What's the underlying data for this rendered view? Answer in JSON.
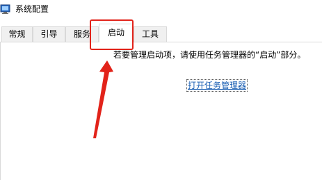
{
  "window": {
    "title": "系统配置",
    "icon": "msconfig-icon"
  },
  "tabs": [
    {
      "label": "常规",
      "active": false
    },
    {
      "label": "引导",
      "active": false
    },
    {
      "label": "服务",
      "active": false
    },
    {
      "label": "启动",
      "active": true
    },
    {
      "label": "工具",
      "active": false
    }
  ],
  "startup": {
    "message": "若要管理启动项，请使用任务管理器的“启动”部分。",
    "link_label": "打开任务管理器"
  },
  "annotation": {
    "color": "#e2231a"
  }
}
